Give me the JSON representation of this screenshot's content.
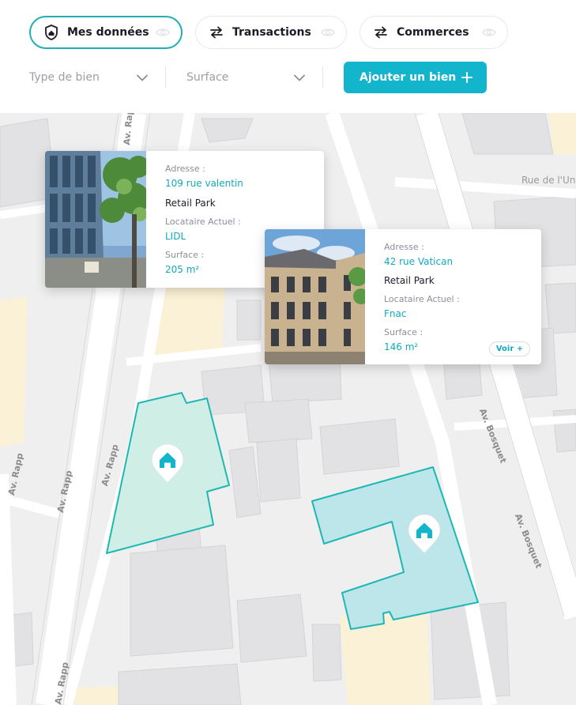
{
  "tabs": [
    {
      "label": "Mes données",
      "icon": "shield-home-icon",
      "active": true
    },
    {
      "label": "Transactions",
      "icon": "swap-arrows-icon",
      "active": false
    },
    {
      "label": "Commerces",
      "icon": "swap-arrows-icon",
      "active": false
    }
  ],
  "filters": {
    "type_placeholder": "Type de bien",
    "surface_placeholder": "Surface"
  },
  "add_button": {
    "label": "Ajouter un bien"
  },
  "map": {
    "streets": [
      "Av. Rapp",
      "Av. Rapp",
      "Av. Rapp",
      "Av. Rapp",
      "Av. Rapp",
      "Av. Bosquet",
      "Av. Bosquet",
      "Rue de l'Un"
    ],
    "colors": {
      "accent": "#12b5cb",
      "parcel_green": "#cfeee6",
      "parcel_blue": "#bde6ea",
      "parcel_stroke": "#1db8b4"
    }
  },
  "cards": [
    {
      "address_label": "Adresse :",
      "address": "109 rue valentin",
      "type": "Retail Park",
      "tenant_label": "Locataire Actuel :",
      "tenant": "LIDL",
      "surface_label": "Surface :",
      "surface": "205 m²"
    },
    {
      "address_label": "Adresse :",
      "address": "42 rue Vatican",
      "type": "Retail Park",
      "tenant_label": "Locataire Actuel :",
      "tenant": "Fnac",
      "surface_label": "Surface :",
      "surface": "146 m²",
      "more_label": "Voir +"
    }
  ]
}
